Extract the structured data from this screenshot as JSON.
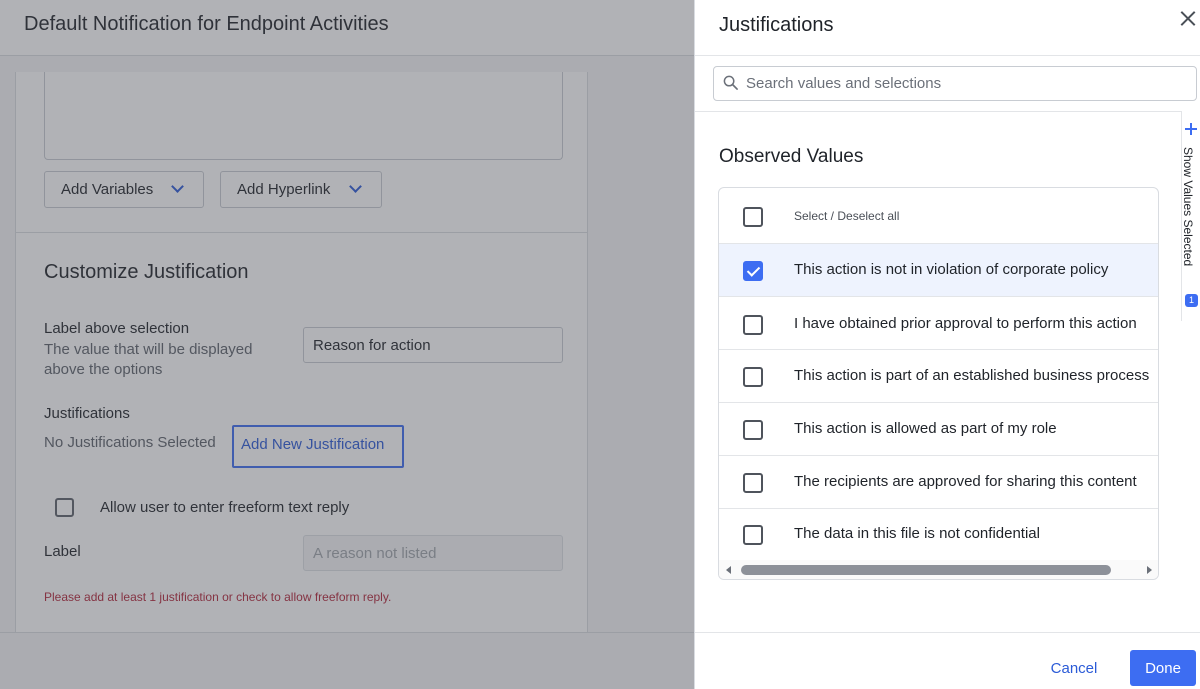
{
  "background": {
    "page_title": "Default Notification for Endpoint Activities",
    "add_variables_label": "Add Variables",
    "add_hyperlink_label": "Add Hyperlink",
    "section_title": "Customize Justification",
    "label_above_selection": "Label above selection",
    "label_above_desc": "The value that will be displayed above the options",
    "label_above_value": "Reason for action",
    "justifications_label": "Justifications",
    "no_justifications_text": "No Justifications Selected",
    "add_new_justification": "Add New Justification",
    "freeform_label": "Allow user to enter freeform text reply",
    "freeform_checked": false,
    "label_field_label": "Label",
    "label_field_placeholder": "A reason not listed",
    "error_text": "Please add at least 1 justification or check to allow freeform reply."
  },
  "panel": {
    "title": "Justifications",
    "search_placeholder": "Search values and selections",
    "observed_title": "Observed Values",
    "select_all_label": "Select / Deselect all",
    "items": [
      {
        "label": "This action is not in violation of corporate policy",
        "checked": true
      },
      {
        "label": "I have obtained prior approval to perform this action",
        "checked": false
      },
      {
        "label": "This action is part of an established business process",
        "checked": false
      },
      {
        "label": "This action is allowed as part of my role",
        "checked": false
      },
      {
        "label": "The recipients are approved for sharing this content",
        "checked": false
      },
      {
        "label": "The data in this file is not confidential",
        "checked": false
      }
    ],
    "side_tab_label": "Show Values Selected",
    "side_tab_count": "1",
    "cancel_label": "Cancel",
    "done_label": "Done"
  },
  "colors": {
    "accent": "#3d6df2",
    "link": "#2b5bd7",
    "error": "#b3263a",
    "overlay": "rgba(68,72,82,0.42)"
  }
}
